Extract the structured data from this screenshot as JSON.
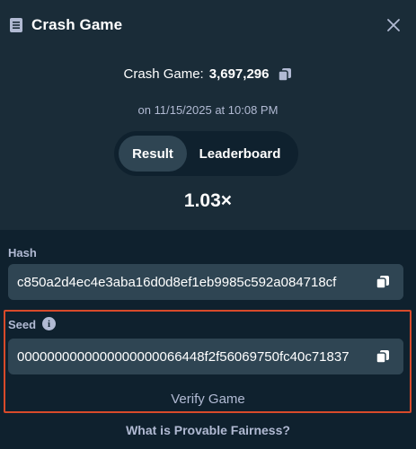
{
  "header": {
    "title": "Crash Game",
    "icon": "document-icon",
    "close_icon": "close-icon"
  },
  "game": {
    "label": "Crash Game:",
    "id": "3,697,296",
    "date": "on 11/15/2025 at 10:08 PM"
  },
  "tabs": [
    {
      "label": "Result",
      "active": true
    },
    {
      "label": "Leaderboard",
      "active": false
    }
  ],
  "result": {
    "multiplier": "1.03×"
  },
  "hash": {
    "label": "Hash",
    "value": "c850a2d4ec4e3aba16d0d8ef1eb9985c592a084718cf"
  },
  "seed": {
    "label": "Seed",
    "value": "0000000000000000000066448f2f56069750fc40c71837"
  },
  "actions": {
    "verify": "Verify Game",
    "fairness": "What is Provable Fairness?"
  },
  "colors": {
    "background": "#1a2c38",
    "panel": "#0f212e",
    "field": "#2f4553",
    "highlight": "#d84a2a",
    "muted_text": "#b1bad3"
  }
}
